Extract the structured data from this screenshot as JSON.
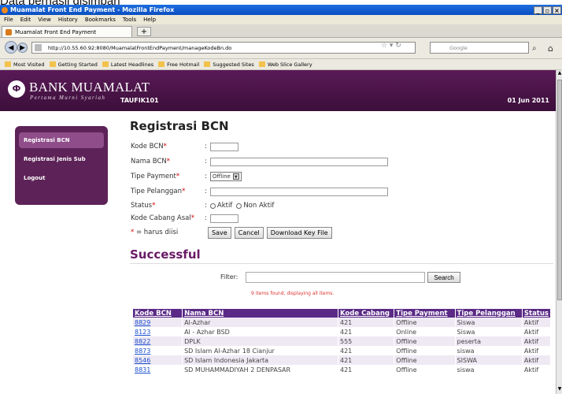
{
  "caption": "Data berhasil disimpan",
  "window": {
    "title": "Muamalat Front End Payment - Mozilla Firefox",
    "controls": [
      "_",
      "▫",
      "×"
    ]
  },
  "menu": [
    "File",
    "Edit",
    "View",
    "History",
    "Bookmarks",
    "Tools",
    "Help"
  ],
  "tab": {
    "label": "Muamalat Front End Payment",
    "new_tab": "+"
  },
  "nav": {
    "url": "http://10.55.60.92:8080/MuamalatFrontEndPayment/manageKodeBn.do",
    "search_placeholder": "Google"
  },
  "bookmarks": [
    "Most Visited",
    "Getting Started",
    "Latest Headlines",
    "Free Hotmail",
    "Suggested Sites",
    "Web Slice Gallery"
  ],
  "banner": {
    "logo_text": "Ф",
    "bank_name": "BANK MUAMALAT",
    "tagline": "Pertama Murni Syariah",
    "user": "TAUFIK101",
    "date": "01 Jun 2011"
  },
  "sidebar": {
    "items": [
      {
        "label": "Registrasi BCN",
        "active": true
      },
      {
        "label": "Registrasi Jenis Sub",
        "active": false
      },
      {
        "label": "Logout",
        "active": false
      }
    ]
  },
  "form": {
    "title": "Registrasi BCN",
    "fields": {
      "kode_bcn": "Kode BCN",
      "nama_bcn": "Nama BCN",
      "tipe_payment": "Tipe Payment",
      "tipe_payment_value": "Offline",
      "tipe_pelanggan": "Tipe Pelanggan",
      "status": "Status",
      "status_aktif": "Aktif",
      "status_non_aktif": "Non Aktif",
      "kode_cabang_asal": "Kode Cabang Asal",
      "required_note": "= harus diisi"
    },
    "buttons": {
      "save": "Save",
      "cancel": "Cancel",
      "download": "Download Key File"
    }
  },
  "result": {
    "title": "Successful",
    "filter_label": "Filter:",
    "search_button": "Search",
    "found_text": "9 items found, displaying all items."
  },
  "table": {
    "headers": [
      "Kode BCN",
      "Nama BCN",
      "Kode Cabang",
      "Tipe Payment",
      "Tipe Pelanggan",
      "Status"
    ],
    "rows": [
      [
        "8829",
        "Al-Azhar",
        "421",
        "Offline",
        "Siswa",
        "Aktif"
      ],
      [
        "8123",
        "Al - Azhar BSD",
        "421",
        "Online",
        "Siswa",
        "Aktif"
      ],
      [
        "8822",
        "DPLK",
        "555",
        "Offline",
        "peserta",
        "Aktif"
      ],
      [
        "8873",
        "SD Islam Al-Azhar 18 Cianjur",
        "421",
        "Offline",
        "siswa",
        "Aktif"
      ],
      [
        "8546",
        "SD Islam Indonesia Jakarta",
        "421",
        "Offline",
        "SISWA",
        "Aktif"
      ],
      [
        "8831",
        "SD MUHAMMADIYAH 2 DENPASAR",
        "421",
        "Offline",
        "siswa",
        "Aktif"
      ]
    ]
  }
}
